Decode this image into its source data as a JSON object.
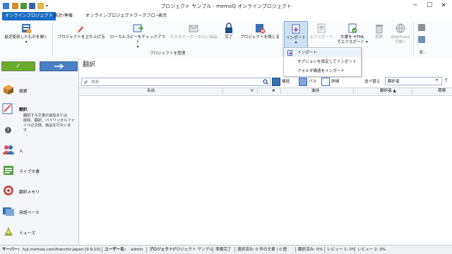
{
  "window": {
    "title": "プロジェクト サンプル - memoQ オンラインプロジェクト",
    "minimize": "─",
    "maximize": "☐",
    "close": "✕"
  },
  "tabs": [
    {
      "label": "オンラインプロジェクト",
      "active": true
    },
    {
      "label": "統計/準備",
      "active": false
    },
    {
      "label": "オンラインプロジェクトワークフロー",
      "active": false
    },
    {
      "label": "表示",
      "active": false
    }
  ],
  "ribbon": {
    "recent_line1": "最近使用したものを開く",
    "recent_arrow": "▾",
    "launch": "プロジェクトを立ち上げる",
    "checkout_line1": "ローカルコピーをチェックアウト",
    "checkout_arrow": "▾",
    "deliver_portal": "カスタマーポータルに納品",
    "complete": "完了",
    "close_project": "プロジェクトを閉じる",
    "group_label": "プロジェクトを管理",
    "import": "インポート",
    "import_arrow": "▾",
    "export": "エクスポート",
    "export_html_line1": "文書を HTML",
    "export_html_line2": "でエクスポート ▾",
    "delete": "削除",
    "webtrans_line1": "WebTrans",
    "webtrans_line2": "で開く",
    "more": "影..."
  },
  "import_menu": [
    {
      "label": "インポート"
    },
    {
      "label": "オプションを設定してインポート"
    },
    {
      "label": "フォルダ構造をインポート"
    }
  ],
  "nav": {
    "ok_glyph": "✓",
    "items": [
      {
        "label": "概要",
        "active": false
      },
      {
        "label": "翻訳",
        "active": true
      },
      {
        "label": "人",
        "active": false
      },
      {
        "label": "ライブ文書",
        "active": false
      },
      {
        "label": "翻訳メモリ",
        "active": false
      },
      {
        "label": "用語ベース",
        "active": false
      },
      {
        "label": "ミューズ",
        "active": false
      }
    ],
    "help_glyph": "?",
    "help_text": [
      "翻訳する文書の追加または",
      "削除、翻訳、バイリンガルファ",
      "イルの交換、納品を行ないま",
      "す"
    ]
  },
  "main": {
    "title": "翻訳",
    "search_placeholder": "検索",
    "filter_structure": "構造",
    "filter_path": "パス",
    "filter_detail": "詳細",
    "sort_label": "並べ替え",
    "sort_value": "翻訳者",
    "columns": [
      "名前",
      "V",
      "#",
      "進捗",
      "翻訳者 ▲",
      "期限"
    ]
  },
  "status": {
    "server_label": "サーバー:",
    "server_value": "fuji.memoq.com/franchir-japan [9.9.10]",
    "user_label": "ユーザー名:",
    "user_value": "admin",
    "project_label": "プロジェクト:",
    "project_value": "プロジェクト サンプル",
    "prep": "準備完了",
    "selected": "選択済み: 0 件の文書 | 0 語",
    "translated": "翻訳済み: 0%",
    "review1": "レビュー 1: 0%",
    "review2": "レビュー 2: 0%"
  },
  "colors": {
    "accent": "#1a6dc4",
    "nav_ok": "#6aaa2a",
    "nav_back": "#4a7fc4",
    "menu_hover": "#eaf2fb"
  }
}
